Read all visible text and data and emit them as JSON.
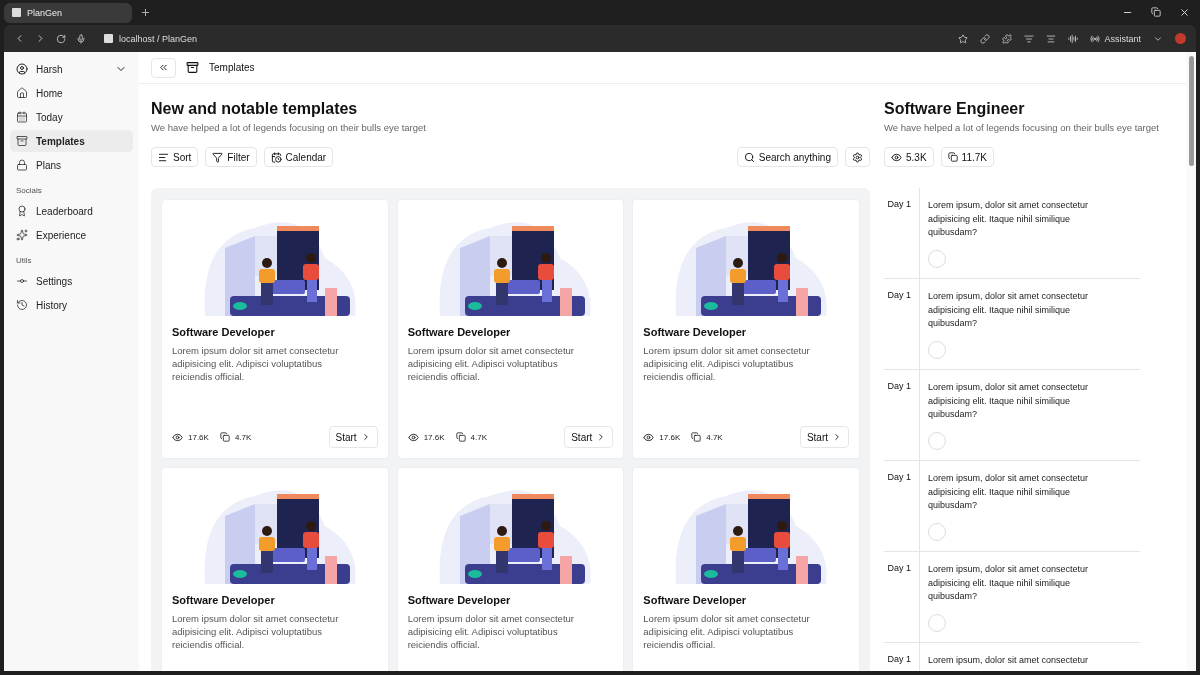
{
  "browser": {
    "tab": {
      "title": "PlanGen",
      "selected": true
    },
    "address": "localhost / PlanGen",
    "assistant": "Assistant"
  },
  "sidebar": {
    "user": "Harsh",
    "sections": [
      {
        "items": [
          {
            "label": "Home",
            "selected": false
          },
          {
            "label": "Today",
            "selected": false
          },
          {
            "label": "Templates",
            "selected": true
          },
          {
            "label": "Plans",
            "selected": false
          }
        ]
      },
      {
        "heading": "Socials",
        "items": [
          {
            "label": "Leaderboard",
            "selected": false
          },
          {
            "label": "Experience",
            "selected": false
          }
        ]
      },
      {
        "heading": "Utils",
        "items": [
          {
            "label": "Settings",
            "selected": false
          },
          {
            "label": "History",
            "selected": false
          }
        ]
      }
    ]
  },
  "header": {
    "title": "Templates"
  },
  "templates": {
    "title": "New and notable templates",
    "subtitle": "We have helped a lot of legends focusing on their bulls eye target",
    "filters": [
      "Sort",
      "Filter",
      "Calendar"
    ],
    "search": "Search anything",
    "cards": [
      {
        "title": "Software Developer",
        "description": "Lorem ipsum dolor sit amet consectetur adipisicing elit. Adipisci voluptatibus reiciendis official.",
        "views": "17.6K",
        "copies": "4.7K",
        "action": "Start"
      },
      {
        "title": "Software Developer",
        "description": "Lorem ipsum dolor sit amet consectetur adipisicing elit. Adipisci voluptatibus reiciendis official.",
        "views": "17.6K",
        "copies": "4.7K",
        "action": "Start"
      },
      {
        "title": "Software Developer",
        "description": "Lorem ipsum dolor sit amet consectetur adipisicing elit. Adipisci voluptatibus reiciendis official.",
        "views": "17.6K",
        "copies": "4.7K",
        "action": "Start"
      },
      {
        "title": "Software Developer",
        "description": "Lorem ipsum dolor sit amet consectetur adipisicing elit. Adipisci voluptatibus reiciendis official."
      },
      {
        "title": "Software Developer",
        "description": "Lorem ipsum dolor sit amet consectetur adipisicing elit. Adipisci voluptatibus reiciendis official."
      },
      {
        "title": "Software Developer",
        "description": "Lorem ipsum dolor sit amet consectetur adipisicing elit. Adipisci voluptatibus reiciendis official."
      }
    ]
  },
  "plan": {
    "title": "Software Engineer",
    "subtitle": "We have helped a lot of legends focusing on their bulls eye target",
    "views": "5.3K",
    "copies": "11.7K",
    "days": [
      {
        "day": "Day 1",
        "task": "Lorem ipsum, dolor sit amet consectetur adipisicing elit. Itaque nihil similique quibusdam?",
        "checked": false
      },
      {
        "day": "Day 1",
        "task": "Lorem ipsum, dolor sit amet consectetur adipisicing elit. Itaque nihil similique quibusdam?",
        "checked": false
      },
      {
        "day": "Day 1",
        "task": "Lorem ipsum, dolor sit amet consectetur adipisicing elit. Itaque nihil similique quibusdam?",
        "checked": false
      },
      {
        "day": "Day 1",
        "task": "Lorem ipsum, dolor sit amet consectetur adipisicing elit. Itaque nihil similique quibusdam?",
        "checked": false
      },
      {
        "day": "Day 1",
        "task": "Lorem ipsum, dolor sit amet consectetur adipisicing elit. Itaque nihil similique quibusdam?",
        "checked": false
      },
      {
        "day": "Day 1",
        "task": "Lorem ipsum, dolor sit amet consectetur"
      }
    ]
  }
}
